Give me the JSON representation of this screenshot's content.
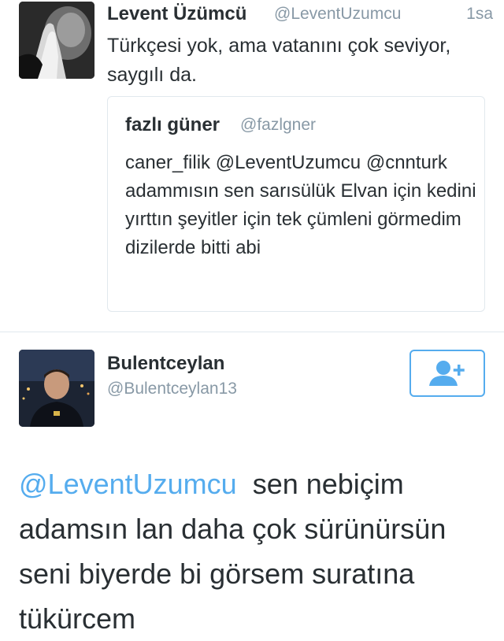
{
  "quoted_tweet": {
    "author_name": "Levent Üzümcü",
    "author_handle": "@LeventUzumcu",
    "time": "1sa",
    "text": "Türkçesi yok, ama vatanını çok seviyor, saygılı da.",
    "avatar_icon": "praying-hands-photo",
    "embedded": {
      "author_name": "fazlı güner",
      "author_handle": "@fazlgner",
      "text": "caner_filik @LeventUzumcu @cnnturk adammısın sen sarısülük Elvan için kedini yırttın şeyitler için tek çümleni görmedim dizilerde bitti abi"
    }
  },
  "main_tweet": {
    "author_name": "Bulentceylan",
    "author_handle": "@Bulentceylan13",
    "avatar_icon": "user-photo",
    "follow_icon": "add-user-icon",
    "mention": "@LeventUzumcu",
    "text": "sen nebiçim adamsın lan daha çok sürünürsün seni biyerde bi görsem suratına tükürcem"
  },
  "colors": {
    "accent": "#55acee",
    "text": "#292f33",
    "muted": "#8899a6",
    "border": "#e1e8ed"
  }
}
